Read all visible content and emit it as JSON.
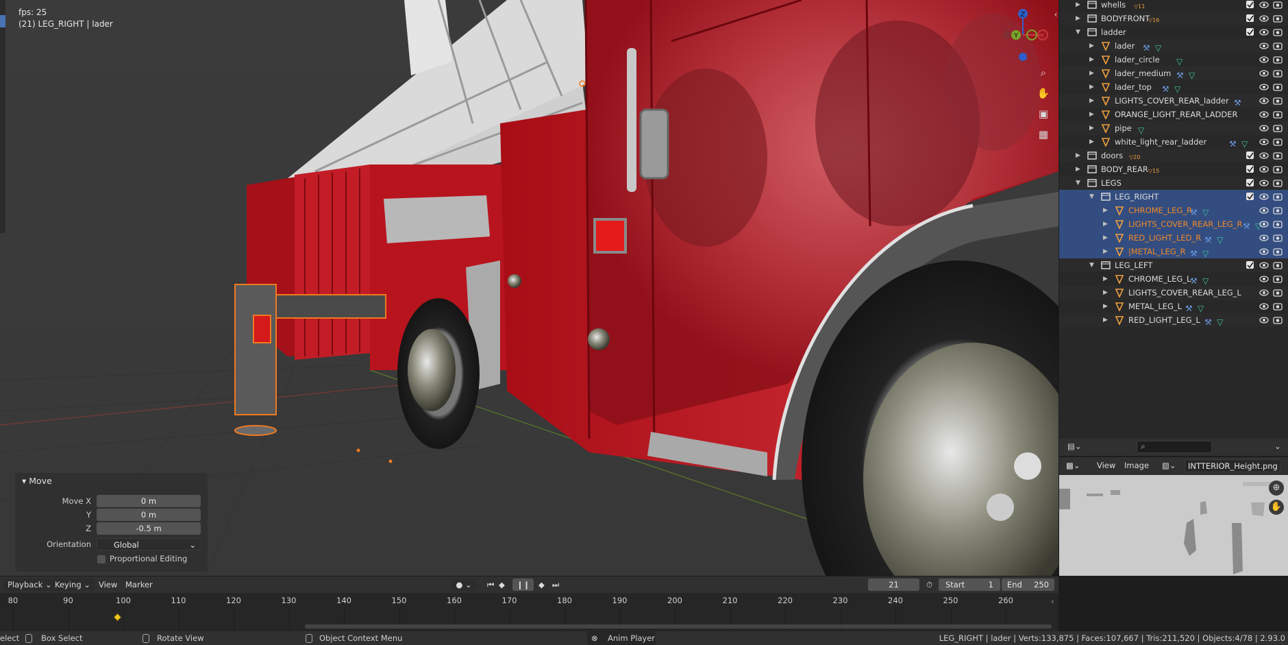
{
  "viewport": {
    "fps": "fps: 25",
    "object_info": "(21) LEG_RIGHT | lader",
    "gizmo_axes": [
      "Z",
      "Y",
      "X"
    ],
    "nav_icons": [
      "zoom-icon",
      "hand-pan-icon",
      "camera-icon",
      "grid-icon"
    ]
  },
  "operator_panel": {
    "title": "Move",
    "fields": [
      {
        "label": "Move X",
        "value": "0 m"
      },
      {
        "label": "Y",
        "value": "0 m"
      },
      {
        "label": "Z",
        "value": "-0.5 m"
      }
    ],
    "orientation_label": "Orientation",
    "orientation_value": "Global",
    "proportional_label": "Proportional Editing"
  },
  "outliner": {
    "rows": [
      {
        "name": "whells",
        "type": "collection",
        "indent": 0,
        "arrow": "right",
        "badge": "11",
        "checkbox": true
      },
      {
        "name": "BODYFRONT",
        "type": "collection",
        "indent": 0,
        "arrow": "right",
        "badge": "16",
        "checkbox": true
      },
      {
        "name": "ladder",
        "type": "collection",
        "indent": 0,
        "arrow": "down",
        "checkbox": true
      },
      {
        "name": "lader",
        "type": "mesh",
        "indent": 1,
        "arrow": "right",
        "mods": [
          "wrench",
          "mesh"
        ]
      },
      {
        "name": "lader_circle",
        "type": "mesh",
        "indent": 1,
        "arrow": "right",
        "mods": [
          "mesh"
        ]
      },
      {
        "name": "lader_medium",
        "type": "mesh",
        "indent": 1,
        "arrow": "right",
        "mods": [
          "wrench",
          "mesh"
        ]
      },
      {
        "name": "lader_top",
        "type": "mesh",
        "indent": 1,
        "arrow": "right",
        "mods": [
          "wrench",
          "mesh"
        ]
      },
      {
        "name": "LIGHTS_COVER_REAR_ladder",
        "type": "mesh",
        "indent": 1,
        "arrow": "right",
        "mods": [
          "wrench"
        ]
      },
      {
        "name": "ORANGE_LIGHT_REAR_LADDER",
        "type": "mesh",
        "indent": 1,
        "arrow": "right",
        "mods": []
      },
      {
        "name": "pipe",
        "type": "mesh",
        "indent": 1,
        "arrow": "right",
        "mods": [
          "mesh"
        ]
      },
      {
        "name": "white_light_rear_ladder",
        "type": "mesh",
        "indent": 1,
        "arrow": "right",
        "mods": [
          "wrench",
          "mesh"
        ]
      },
      {
        "name": "doors",
        "type": "collection",
        "indent": 0,
        "arrow": "right",
        "badge": "20",
        "checkbox": true
      },
      {
        "name": "BODY_REAR",
        "type": "collection",
        "indent": 0,
        "arrow": "right",
        "badge": "15",
        "checkbox": true
      },
      {
        "name": "LEGS",
        "type": "collection",
        "indent": 0,
        "arrow": "down",
        "checkbox": true
      },
      {
        "name": "LEG_RIGHT",
        "type": "collection",
        "indent": 1,
        "arrow": "down",
        "checkbox": true,
        "selected": true
      },
      {
        "name": "CHROME_LEG_R",
        "type": "mesh",
        "indent": 2,
        "arrow": "right",
        "mods": [
          "wrench",
          "mesh"
        ],
        "selected": true,
        "orange": true
      },
      {
        "name": "LIGHTS_COVER_REAR_LEG_R",
        "type": "mesh",
        "indent": 2,
        "arrow": "right",
        "mods": [
          "wrench",
          "mesh"
        ],
        "selected": true,
        "orange": true
      },
      {
        "name": "RED_LIGHT_LED_R",
        "type": "mesh",
        "indent": 2,
        "arrow": "right",
        "mods": [
          "wrench",
          "mesh"
        ],
        "selected": true,
        "orange": true
      },
      {
        "name": "|METAL_LEG_R",
        "type": "mesh",
        "indent": 2,
        "arrow": "right",
        "mods": [
          "wrench",
          "mesh"
        ],
        "selected": true,
        "orange": true
      },
      {
        "name": "LEG_LEFT",
        "type": "collection",
        "indent": 1,
        "arrow": "down",
        "checkbox": true
      },
      {
        "name": "CHROME_LEG_L",
        "type": "mesh",
        "indent": 2,
        "arrow": "right",
        "mods": [
          "wrench",
          "mesh"
        ]
      },
      {
        "name": "LIGHTS_COVER_REAR_LEG_L",
        "type": "mesh",
        "indent": 2,
        "arrow": "right",
        "mods": []
      },
      {
        "name": "METAL_LEG_L",
        "type": "mesh",
        "indent": 2,
        "arrow": "right",
        "mods": [
          "wrench",
          "mesh"
        ]
      },
      {
        "name": "RED_LIGHT_LEG_L",
        "type": "mesh",
        "indent": 2,
        "arrow": "right",
        "mods": [
          "wrench",
          "mesh"
        ]
      }
    ]
  },
  "image_editor": {
    "menu_view": "View",
    "menu_image": "Image",
    "image_name": "INTTERIOR_Height.png"
  },
  "timeline": {
    "menus": [
      "Playback",
      "Keying",
      "View",
      "Marker"
    ],
    "current_frame": "21",
    "start_label": "Start",
    "start_value": "1",
    "end_label": "End",
    "end_value": "250",
    "ruler": [
      80,
      90,
      100,
      110,
      120,
      130,
      140,
      150,
      160,
      170,
      180,
      190,
      200,
      210,
      220,
      230,
      240,
      250,
      260
    ],
    "keyframe_at": 99
  },
  "status_bar": {
    "select": "elect",
    "box_select": "Box Select",
    "rotate_view": "Rotate View",
    "context_menu": "Object Context Menu",
    "anim_player": "Anim Player",
    "stats": "LEG_RIGHT | lader | Verts:133,875 | Faces:107,667 | Tris:211,520 | Objects:4/78 | 2.93.0"
  },
  "colors": {
    "accent": "#4772b3",
    "selection_row": "#334d80",
    "selected_text": "#f08a28",
    "truck_red": "#b3101a"
  }
}
